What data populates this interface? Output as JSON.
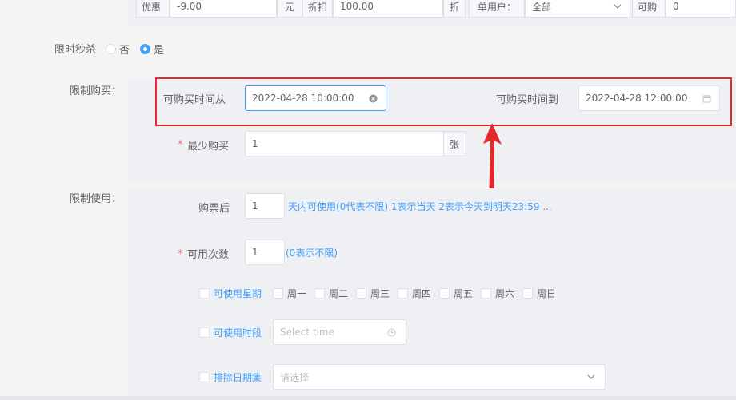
{
  "top_row": {
    "discount_label": "优惠",
    "discount_value": "-9.00",
    "discount_unit": "元",
    "rebate_label": "折扣",
    "rebate_value": "100.00",
    "rebate_unit": "折",
    "single_user_label": "单用户：",
    "single_user_value": "全部",
    "can_buy_label": "可购",
    "can_buy_value": "0"
  },
  "flash_sale": {
    "label": "限时秒杀",
    "option_no": "否",
    "option_yes": "是",
    "selected": "是"
  },
  "purchase_limit": {
    "label": "限制购买：",
    "from_label": "可购买时间从",
    "from_value": "2022-04-28 10:00:00",
    "to_label": "可购买时间到",
    "to_value": "2022-04-28 12:00:00",
    "min_label": "最少购买",
    "min_value": "1",
    "min_unit": "张",
    "required_mark": "*"
  },
  "usage_limit": {
    "label": "限制使用：",
    "after_label": "购票后",
    "after_value": "1",
    "after_hint": "天内可使用(0代表不限) 1表示当天 2表示今天到明天23:59 ...",
    "count_label": "可用次数",
    "count_value": "1",
    "count_hint": "(0表示不限)",
    "required_mark": "*",
    "weekday_label": "可使用星期",
    "weekdays": [
      "周一",
      "周二",
      "周三",
      "周四",
      "周五",
      "周六",
      "周日"
    ],
    "period_label": "可使用时段",
    "period_placeholder": "Select time",
    "exclude_label": "排除日期集",
    "exclude_placeholder": "请选择"
  },
  "colors": {
    "accent": "#409eff",
    "highlight_box": "#e5282b",
    "arrow": "#e5282b",
    "required": "#f56c6c"
  }
}
